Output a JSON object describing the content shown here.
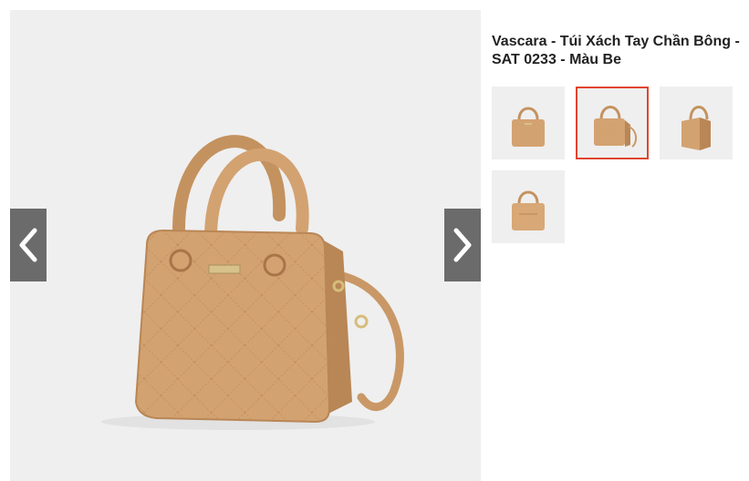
{
  "product": {
    "title": "Vascara - Túi Xách Tay Chần Bông - SAT 0233 - Màu Be"
  },
  "gallery": {
    "main_image": "beige-quilted-handbag-image",
    "prev_icon": "chevron-left-icon",
    "next_icon": "chevron-right-icon",
    "thumbnails": [
      {
        "image": "handbag-front-view",
        "active": false
      },
      {
        "image": "handbag-angle-view",
        "active": true
      },
      {
        "image": "handbag-side-view",
        "active": false
      },
      {
        "image": "handbag-back-view",
        "active": false
      }
    ]
  },
  "colors": {
    "bag": "#d3a271",
    "bag_dark": "#b98655",
    "background": "#efefef",
    "active_border": "#e0452f",
    "nav_button": "#6b6b6b"
  }
}
